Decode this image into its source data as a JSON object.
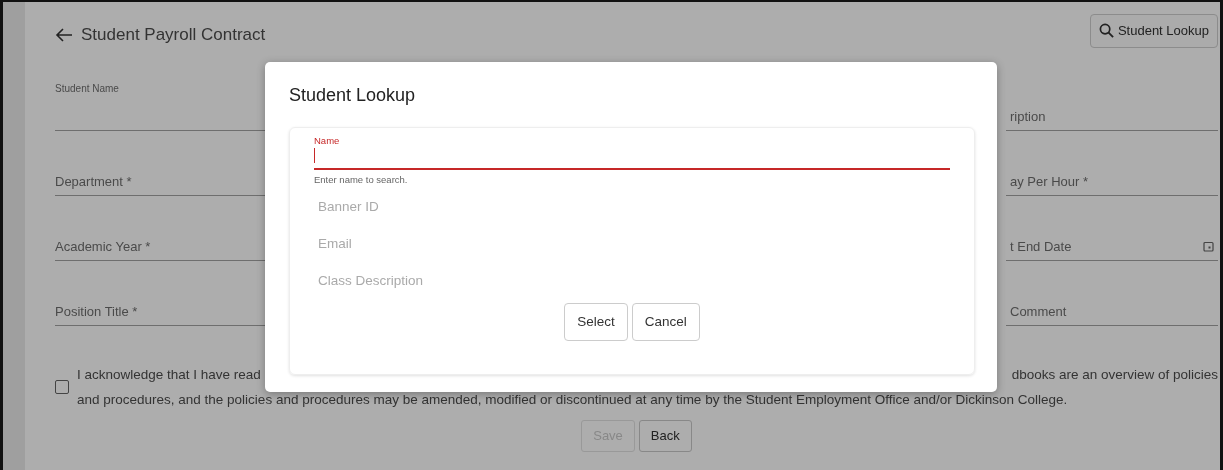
{
  "page": {
    "title": "Student Payroll Contract",
    "lookup_button": "Student Lookup"
  },
  "left_fields": [
    {
      "label": "Student Name",
      "floated": true
    },
    {
      "label": "Department *",
      "floated": false
    },
    {
      "label": "Academic Year *",
      "floated": false
    },
    {
      "label": "Position Title *",
      "floated": false
    }
  ],
  "right_fields": [
    {
      "label": "ription",
      "kind": "text"
    },
    {
      "label": "ay Per Hour *",
      "kind": "text"
    },
    {
      "label": "t End Date",
      "kind": "date"
    },
    {
      "label": "Comment",
      "kind": "text"
    }
  ],
  "acknowledgement": {
    "checked": false,
    "line_1_start": "I acknowledge that I have read",
    "line_1_end": "dbooks are an overview of policies",
    "line_2": "and procedures, and the policies and procedures may be amended, modified or discontinued at any time by the Student Employment Office and/or Dickinson College."
  },
  "buttons": [
    {
      "label": "Save",
      "disabled": true
    },
    {
      "label": "Back",
      "disabled": false
    }
  ],
  "modal": {
    "title": "Student Lookup",
    "name_field": {
      "label": "Name",
      "helper": "Enter name to search.",
      "focused": true
    },
    "fields": [
      {
        "placeholder": "Banner ID"
      },
      {
        "placeholder": "Email"
      },
      {
        "placeholder": "Class Description"
      }
    ],
    "buttons": [
      "Select",
      "Cancel"
    ]
  }
}
